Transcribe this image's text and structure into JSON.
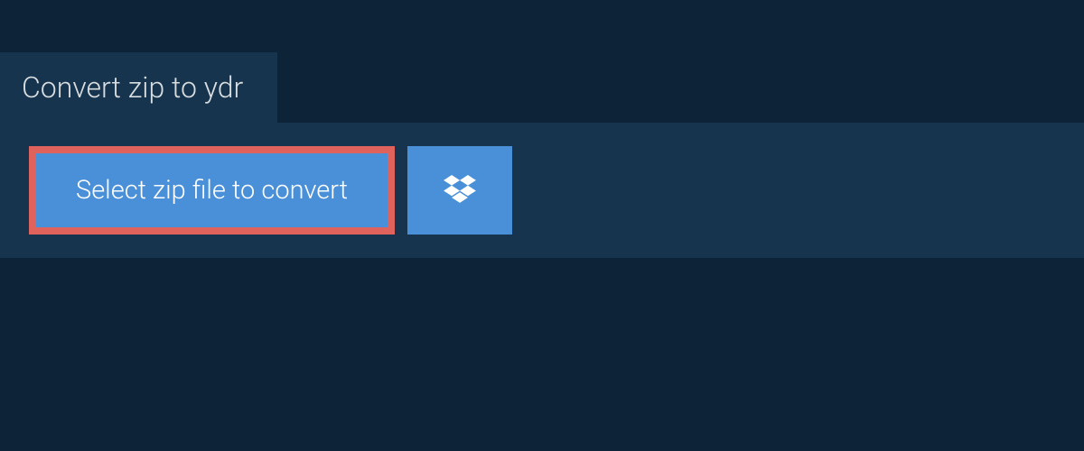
{
  "tab": {
    "label": "Convert zip to ydr"
  },
  "actions": {
    "select_file_label": "Select zip file to convert"
  },
  "colors": {
    "background": "#0d2438",
    "panel": "#16344e",
    "button": "#4a90d9",
    "highlight_border": "#e0625c"
  }
}
